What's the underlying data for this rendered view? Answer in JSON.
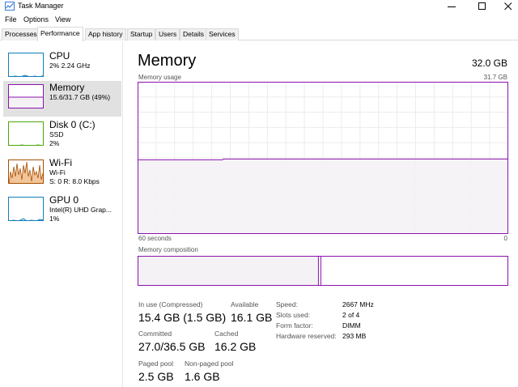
{
  "window": {
    "title": "Task Manager"
  },
  "menu": [
    "File",
    "Options",
    "View"
  ],
  "tabs": [
    "Processes",
    "Performance",
    "App history",
    "Startup",
    "Users",
    "Details",
    "Services"
  ],
  "sidebar": {
    "items": [
      {
        "name": "CPU",
        "line2": "2% 2.24 GHz",
        "line3": ""
      },
      {
        "name": "Memory",
        "line2": "15.6/31.7 GB (49%)",
        "line3": ""
      },
      {
        "name": "Disk 0 (C:)",
        "line2": "SSD",
        "line3": "2%"
      },
      {
        "name": "Wi-Fi",
        "line2": "Wi-Fi",
        "line3": "S: 0 R: 8.0 Kbps"
      },
      {
        "name": "GPU 0",
        "line2": "Intel(R) UHD Grap...",
        "line3": "1%"
      }
    ]
  },
  "memory": {
    "title": "Memory",
    "total": "32.0 GB",
    "usage_label": "Memory usage",
    "usage_max": "31.7 GB",
    "graph_left": "60 seconds",
    "graph_right": "0",
    "usage_level": 0.49,
    "composition_label": "Memory composition",
    "composition_in_use_fraction": 0.49,
    "stats": {
      "in_use_label": "In use (Compressed)",
      "in_use_value": "15.4 GB (1.5 GB)",
      "available_label": "Available",
      "available_value": "16.1 GB",
      "committed_label": "Committed",
      "committed_value": "27.0/36.5 GB",
      "cached_label": "Cached",
      "cached_value": "16.2 GB",
      "paged_label": "Paged pool",
      "paged_value": "2.5 GB",
      "nonpaged_label": "Non-paged pool",
      "nonpaged_value": "1.6 GB"
    },
    "details": [
      {
        "key": "Speed:",
        "value": "2667 MHz"
      },
      {
        "key": "Slots used:",
        "value": "2 of 4"
      },
      {
        "key": "Form factor:",
        "value": "DIMM"
      },
      {
        "key": "Hardware reserved:",
        "value": "293 MB"
      }
    ]
  },
  "colors": {
    "memory": "#8b12ae",
    "memory_fill": "#f4f2f4",
    "cpu": "#117dbb",
    "disk": "#4da60c",
    "wifi": "#a74f01",
    "gpu": "#117dbb",
    "grid": "#ececec"
  }
}
